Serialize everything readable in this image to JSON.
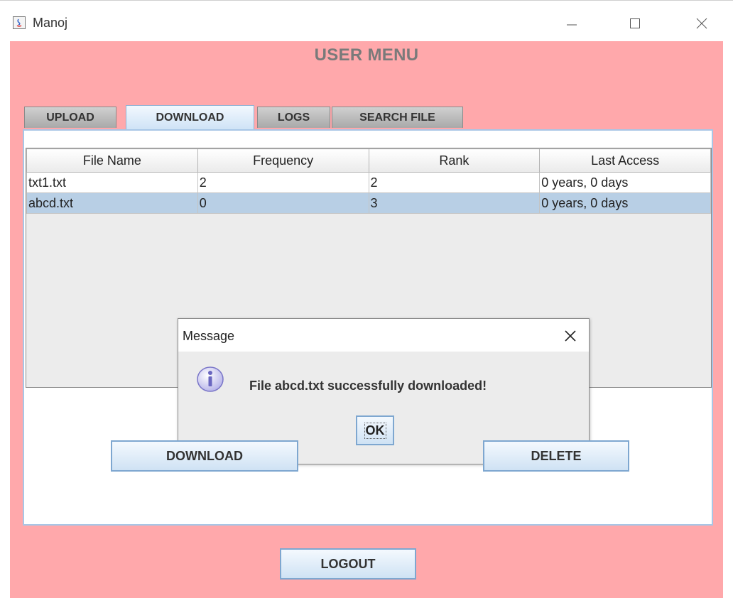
{
  "window": {
    "title": "Manoj"
  },
  "header": {
    "title": "USER MENU"
  },
  "tabs": [
    {
      "label": "UPLOAD",
      "selected": false
    },
    {
      "label": "DOWNLOAD",
      "selected": true
    },
    {
      "label": "LOGS",
      "selected": false
    },
    {
      "label": "SEARCH FILE",
      "selected": false
    }
  ],
  "table": {
    "columns": [
      "File Name",
      "Frequency",
      "Rank",
      "Last Access"
    ],
    "rows": [
      {
        "cells": [
          "txt1.txt",
          "2",
          "2",
          "0 years, 0 days"
        ],
        "selected": false
      },
      {
        "cells": [
          "abcd.txt",
          "0",
          "3",
          "0 years, 0 days"
        ],
        "selected": true
      }
    ]
  },
  "dialog": {
    "title": "Message",
    "message": "File abcd.txt successfully downloaded!",
    "ok_label": "OK"
  },
  "buttons": {
    "download_label": "DOWNLOAD",
    "delete_label": "DELETE",
    "logout_label": "LOGOUT"
  },
  "colors": {
    "background": "#ffa8ab",
    "selected_row": "#b8cfe5",
    "button_border": "#7ea7d0"
  }
}
